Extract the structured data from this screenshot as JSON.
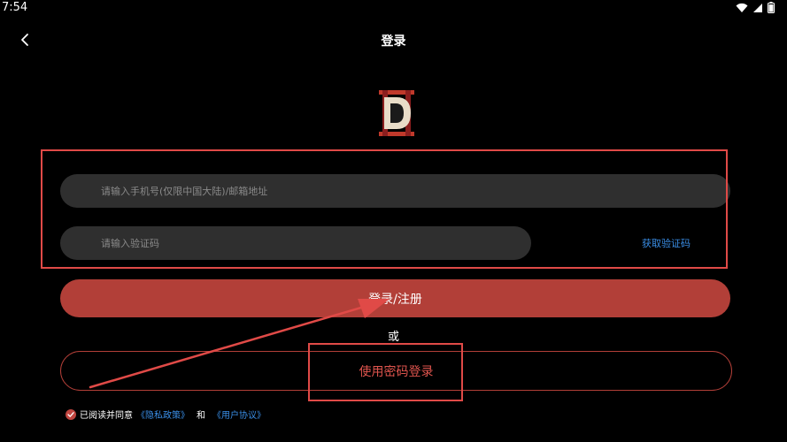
{
  "status_bar": {
    "time": "7:54"
  },
  "header": {
    "title": "登录"
  },
  "form": {
    "phone_placeholder": "请输入手机号(仅限中国大陆)/邮箱地址",
    "code_placeholder": "请输入验证码",
    "get_code_label": "获取验证码"
  },
  "actions": {
    "login_label": "登录/注册",
    "or_label": "或",
    "password_login_label": "使用密码登录"
  },
  "agreement": {
    "prefix": "已阅读并同意",
    "privacy_link": "《隐私政策》",
    "and_text": "和",
    "user_link": "《用户协议》"
  },
  "colors": {
    "background": "#000000",
    "primary": "#b23f38",
    "input_bg": "#2f2f2f",
    "link": "#3a8ee6",
    "annotation": "#e04a47"
  },
  "icons": [
    "wifi-icon",
    "signal-icon",
    "battery-icon",
    "back-arrow-icon",
    "app-logo-icon",
    "check-icon"
  ]
}
